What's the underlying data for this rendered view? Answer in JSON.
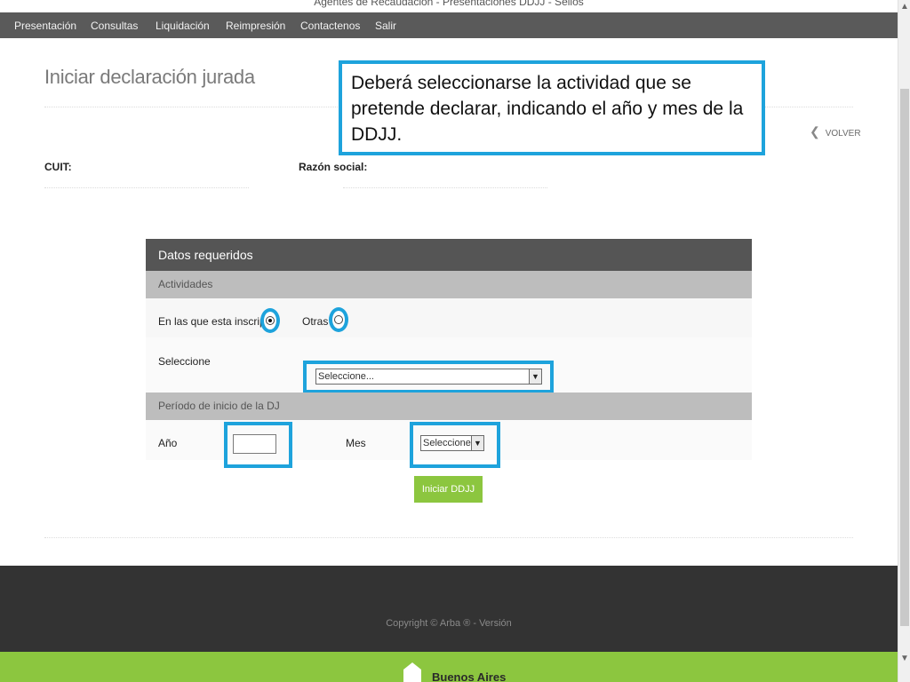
{
  "window": {
    "title": "Agentes de Recaudación - Presentaciones DDJJ - Sellos"
  },
  "nav": {
    "items": [
      "Presentación",
      "Consultas",
      "Liquidación",
      "Reimpresión",
      "Contactenos",
      "Salir"
    ]
  },
  "page": {
    "title": "Iniciar declaración jurada",
    "volver": "VOLVER",
    "cuit_label": "CUIT:",
    "razon_social_label": "Razón social:"
  },
  "callout": {
    "text": "Deberá seleccionarse la actividad que se pretende declarar, indicando el año y mes de la DDJJ."
  },
  "form": {
    "header": "Datos requeridos",
    "actividades_section": "Actividades",
    "radio_inscripto_label": "En las que esta inscripto",
    "radio_inscripto_checked": true,
    "radio_otras_label": "Otras",
    "radio_otras_checked": false,
    "seleccione_label": "Seleccione",
    "actividad_select_value": "Seleccione...",
    "periodo_section": "Período de inicio de la DJ",
    "anio_label": "Año",
    "anio_value": "",
    "mes_label": "Mes",
    "mes_select_value": "Seleccione...",
    "submit_label": "Iniciar DDJJ"
  },
  "footer": {
    "copyright": "Copyright © Arba ® - Versión",
    "logo_text": "Buenos Aires"
  },
  "colors": {
    "highlight": "#1ea3dc",
    "accent_green": "#8cc63f",
    "nav_bg": "#5a5a5a",
    "footer_bg": "#333333"
  },
  "icons": {
    "volver": "chevron-left-icon",
    "dropdown": "chevron-down-icon",
    "logo": "buenos-aires-logo-icon"
  }
}
